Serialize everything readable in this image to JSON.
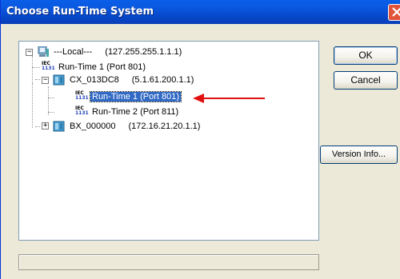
{
  "window": {
    "title": "Choose Run-Time System"
  },
  "tree": {
    "items": [
      {
        "label": "---Local---",
        "address": "(127.255.255.1.1.1)"
      },
      {
        "label": "Run-Time 1 (Port 801)"
      },
      {
        "label": "CX_013DC8",
        "address": "(5.1.61.200.1.1)"
      },
      {
        "label": "Run-Time 1 (Port 801)",
        "selected": true
      },
      {
        "label": "Run-Time 2 (Port 811)"
      },
      {
        "label": "BX_000000",
        "address": "(172.16.21.20.1.1)"
      }
    ],
    "iec_top": "IEC",
    "iec_bottom": "1131"
  },
  "buttons": {
    "ok": "OK",
    "cancel": "Cancel",
    "version_info": "Version Info..."
  },
  "colors": {
    "selection": "#316ac5",
    "arrow": "#e01010",
    "titlebar": "#0a59e0"
  }
}
